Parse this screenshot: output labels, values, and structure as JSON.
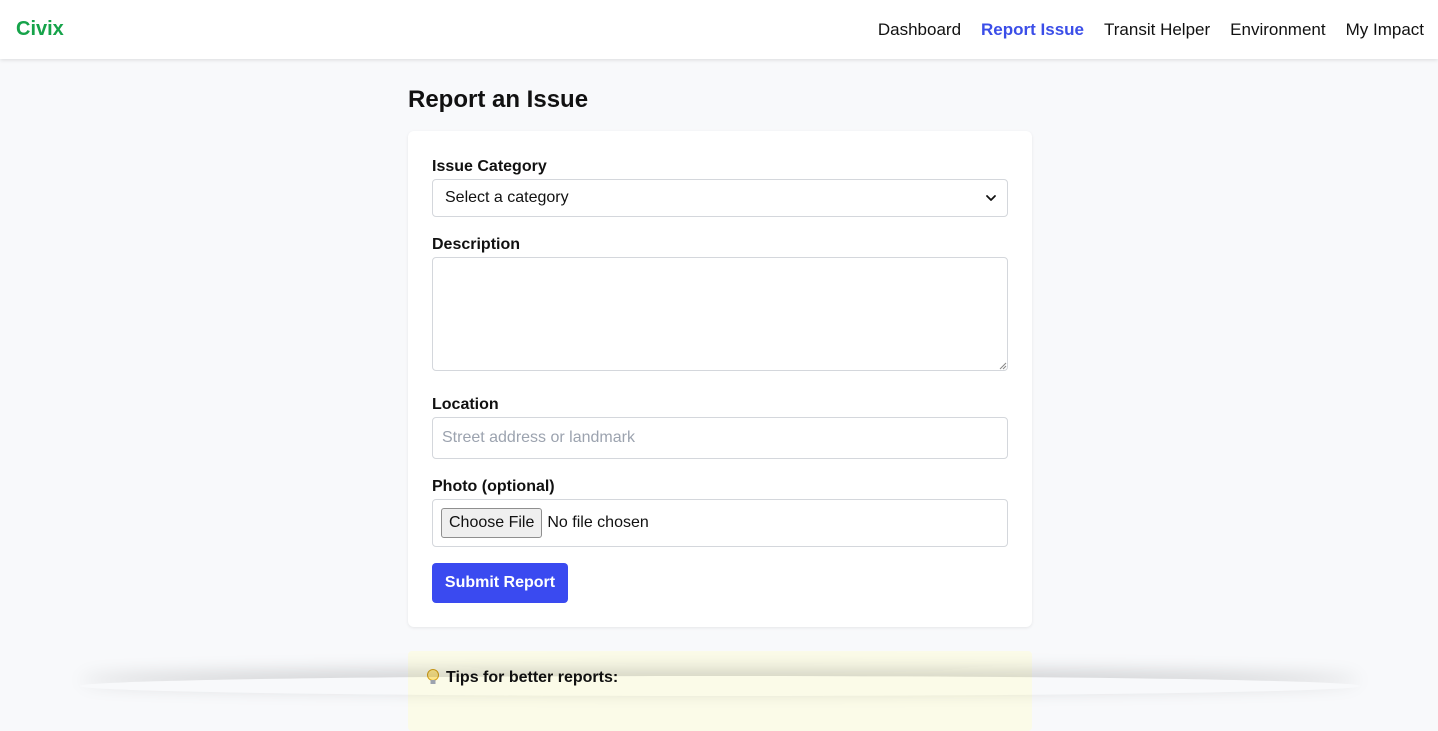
{
  "brand": {
    "name": "Civix",
    "color": "#16a34a"
  },
  "nav": {
    "items": [
      {
        "label": "Dashboard",
        "active": false
      },
      {
        "label": "Report Issue",
        "active": true
      },
      {
        "label": "Transit Helper",
        "active": false
      },
      {
        "label": "Environment",
        "active": false
      },
      {
        "label": "My Impact",
        "active": false
      }
    ]
  },
  "page": {
    "title": "Report an Issue"
  },
  "form": {
    "category_label": "Issue Category",
    "category_selected": "Select a category",
    "description_label": "Description",
    "description_value": "",
    "location_label": "Location",
    "location_placeholder": "Street address or landmark",
    "photo_label": "Photo (optional)",
    "photo_button": "Choose File",
    "photo_status": "No file chosen",
    "submit_label": "Submit Report"
  },
  "tips": {
    "title": "Tips for better reports:",
    "icon": "lightbulb-icon"
  },
  "colors": {
    "accent": "#3a4af0",
    "active_nav": "#3b4ee8",
    "tips_bg": "#fbfbe8"
  }
}
